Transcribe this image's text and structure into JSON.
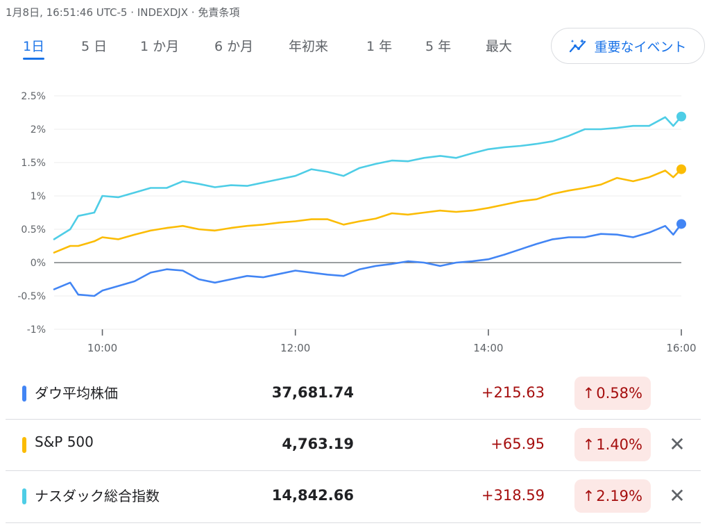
{
  "header": {
    "timestamp": "1月8日, 16:51:46 UTC-5",
    "separator": "·",
    "index_code": "INDEXDJX",
    "disclaimer": "免責条項"
  },
  "tabs": [
    {
      "label": "1日",
      "active": true
    },
    {
      "label": "5 日",
      "active": false
    },
    {
      "label": "1 か月",
      "active": false
    },
    {
      "label": "6 か月",
      "active": false
    },
    {
      "label": "年初来",
      "active": false
    },
    {
      "label": "1 年",
      "active": false
    },
    {
      "label": "5 年",
      "active": false
    },
    {
      "label": "最大",
      "active": false
    }
  ],
  "events_button": {
    "label": "重要なイベント",
    "icon": "insights-icon"
  },
  "colors": {
    "accent": "#1a73e8",
    "dow": "#4285f4",
    "sp500": "#fbbc04",
    "nasdaq": "#4ecde6",
    "positive_text": "#a50e0e",
    "positive_bg": "#fce8e6"
  },
  "chart_data": {
    "type": "line",
    "x_unit": "time of day",
    "xlim": [
      "09:30",
      "16:00"
    ],
    "ylim": [
      -1.0,
      2.5
    ],
    "x_ticks": [
      "10:00",
      "12:00",
      "14:00",
      "16:00"
    ],
    "y_ticks": [
      "2.5%",
      "2%",
      "1.5%",
      "1%",
      "0.5%",
      "0%",
      "-0.5%",
      "-1%"
    ],
    "y_tick_values": [
      2.5,
      2.0,
      1.5,
      1.0,
      0.5,
      0.0,
      -0.5,
      -1.0
    ],
    "baseline": 0.0,
    "grid": true,
    "series": [
      {
        "name": "ナスダック総合指数",
        "color": "#4ecde6",
        "x": [
          "09:30",
          "09:40",
          "09:45",
          "09:55",
          "10:00",
          "10:10",
          "10:20",
          "10:30",
          "10:40",
          "10:50",
          "11:00",
          "11:10",
          "11:20",
          "11:30",
          "11:40",
          "11:50",
          "12:00",
          "12:10",
          "12:20",
          "12:30",
          "12:40",
          "12:50",
          "13:00",
          "13:10",
          "13:20",
          "13:30",
          "13:40",
          "13:50",
          "14:00",
          "14:10",
          "14:20",
          "14:30",
          "14:40",
          "14:50",
          "15:00",
          "15:10",
          "15:20",
          "15:30",
          "15:40",
          "15:50",
          "15:55",
          "16:00"
        ],
        "y": [
          0.35,
          0.5,
          0.7,
          0.75,
          1.0,
          0.98,
          1.05,
          1.12,
          1.12,
          1.22,
          1.18,
          1.13,
          1.16,
          1.15,
          1.2,
          1.25,
          1.3,
          1.4,
          1.36,
          1.3,
          1.42,
          1.48,
          1.53,
          1.52,
          1.57,
          1.6,
          1.57,
          1.64,
          1.7,
          1.73,
          1.75,
          1.78,
          1.82,
          1.9,
          2.0,
          2.0,
          2.02,
          2.05,
          2.05,
          2.18,
          2.05,
          2.19
        ]
      },
      {
        "name": "S&P 500",
        "color": "#fbbc04",
        "x": [
          "09:30",
          "09:40",
          "09:45",
          "09:55",
          "10:00",
          "10:10",
          "10:20",
          "10:30",
          "10:40",
          "10:50",
          "11:00",
          "11:10",
          "11:20",
          "11:30",
          "11:40",
          "11:50",
          "12:00",
          "12:10",
          "12:20",
          "12:30",
          "12:40",
          "12:50",
          "13:00",
          "13:10",
          "13:20",
          "13:30",
          "13:40",
          "13:50",
          "14:00",
          "14:10",
          "14:20",
          "14:30",
          "14:40",
          "14:50",
          "15:00",
          "15:10",
          "15:20",
          "15:30",
          "15:40",
          "15:50",
          "15:55",
          "16:00"
        ],
        "y": [
          0.15,
          0.25,
          0.25,
          0.32,
          0.38,
          0.35,
          0.42,
          0.48,
          0.52,
          0.55,
          0.5,
          0.48,
          0.52,
          0.55,
          0.57,
          0.6,
          0.62,
          0.65,
          0.65,
          0.57,
          0.62,
          0.66,
          0.74,
          0.72,
          0.75,
          0.78,
          0.76,
          0.78,
          0.82,
          0.87,
          0.92,
          0.95,
          1.03,
          1.08,
          1.12,
          1.17,
          1.27,
          1.22,
          1.28,
          1.38,
          1.28,
          1.4
        ]
      },
      {
        "name": "ダウ平均株価",
        "color": "#4285f4",
        "x": [
          "09:30",
          "09:40",
          "09:45",
          "09:55",
          "10:00",
          "10:10",
          "10:20",
          "10:30",
          "10:40",
          "10:50",
          "11:00",
          "11:10",
          "11:20",
          "11:30",
          "11:40",
          "11:50",
          "12:00",
          "12:10",
          "12:20",
          "12:30",
          "12:40",
          "12:50",
          "13:00",
          "13:10",
          "13:20",
          "13:30",
          "13:40",
          "13:50",
          "14:00",
          "14:10",
          "14:20",
          "14:30",
          "14:40",
          "14:50",
          "15:00",
          "15:10",
          "15:20",
          "15:30",
          "15:40",
          "15:50",
          "15:55",
          "16:00"
        ],
        "y": [
          -0.4,
          -0.3,
          -0.48,
          -0.5,
          -0.42,
          -0.35,
          -0.28,
          -0.15,
          -0.1,
          -0.12,
          -0.25,
          -0.3,
          -0.25,
          -0.2,
          -0.22,
          -0.17,
          -0.12,
          -0.15,
          -0.18,
          -0.2,
          -0.1,
          -0.05,
          -0.02,
          0.02,
          0.0,
          -0.05,
          0.0,
          0.02,
          0.05,
          0.12,
          0.2,
          0.28,
          0.35,
          0.38,
          0.38,
          0.43,
          0.42,
          0.38,
          0.45,
          0.55,
          0.42,
          0.58
        ]
      }
    ]
  },
  "legend_rows": [
    {
      "name": "ダウ平均株価",
      "price": "37,681.74",
      "change": "+215.63",
      "arrow": "↑",
      "pct": "0.58%",
      "color": "#4285f4",
      "closable": false
    },
    {
      "name": "S&P 500",
      "price": "4,763.19",
      "change": "+65.95",
      "arrow": "↑",
      "pct": "1.40%",
      "color": "#fbbc04",
      "closable": true
    },
    {
      "name": "ナスダック総合指数",
      "price": "14,842.66",
      "change": "+318.59",
      "arrow": "↑",
      "pct": "2.19%",
      "color": "#4ecde6",
      "closable": true
    }
  ],
  "close_icon": "close-icon"
}
